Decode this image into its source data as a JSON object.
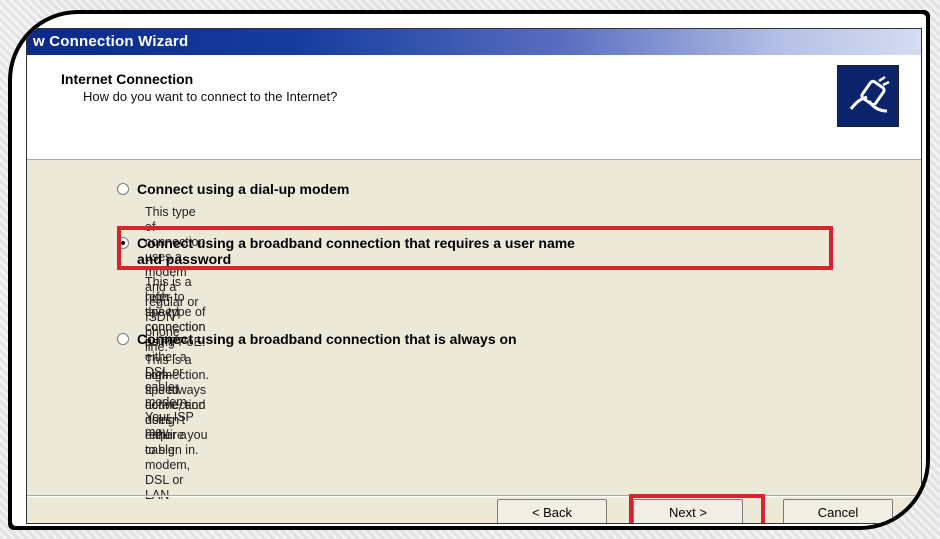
{
  "window": {
    "title": "w Connection Wizard"
  },
  "header": {
    "title": "Internet Connection",
    "subtitle": "How do you want to connect to the Internet?",
    "icon": "network-cable-icon"
  },
  "options": [
    {
      "label": "Connect using a dial-up modem",
      "description": "This type of connection uses a modem and a regular or ISDN phone line.",
      "selected": false
    },
    {
      "label_line1": "Connect using a broadband connection that requires a user name",
      "label_line2": "and password",
      "description_line1": "This is a high-speed connection using either a DSL or cable modem. Your ISP may",
      "description_line2": "refer to this type of connection as PPPoE.",
      "selected": true
    },
    {
      "label": "Connect using a broadband connection that is always on",
      "description_line1": "This is a high-speed connection using either a cable modem, DSL or LAN",
      "description_line2": "connection. It is always active, and doesn't require you to sign in.",
      "selected": false
    }
  ],
  "buttons": {
    "back": "< Back",
    "next": "Next >",
    "cancel": "Cancel"
  },
  "colors": {
    "highlight": "#d7242b",
    "titlebar": "#0b2a8a"
  }
}
